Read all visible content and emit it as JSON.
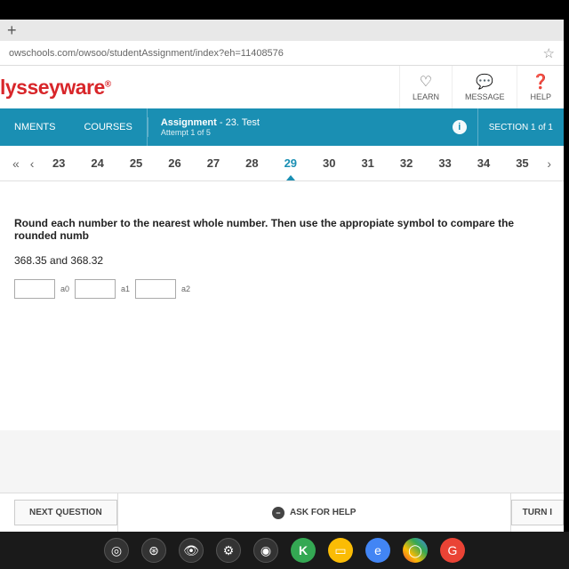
{
  "browser": {
    "url": "owschools.com/owsoo/studentAssignment/index?eh=11408576",
    "new_tab": "+"
  },
  "header": {
    "logo": "lysseyware",
    "logo_suffix": "®",
    "nav": {
      "learn": "LEARN",
      "message": "MESSAGE",
      "help": "HELP"
    }
  },
  "blue_bar": {
    "tab1": "NMENTS",
    "tab2": "COURSES",
    "assignment_label": "Assignment",
    "assignment_name": "- 23. Test",
    "attempt": "Attempt 1 of 5",
    "section": "SECTION 1 of 1"
  },
  "question_nav": {
    "numbers": [
      "23",
      "24",
      "25",
      "26",
      "27",
      "28",
      "29",
      "30",
      "31",
      "32",
      "33",
      "34",
      "35"
    ],
    "active": "29"
  },
  "question": {
    "prompt": "Round each number to the nearest whole number. Then use the appropiate symbol to compare the rounded numb",
    "values": "368.35 and 368.32",
    "labels": [
      "a0",
      "a1",
      "a2"
    ]
  },
  "footer": {
    "next": "NEXT QUESTION",
    "ask": "ASK FOR HELP",
    "turn": "TURN I"
  }
}
